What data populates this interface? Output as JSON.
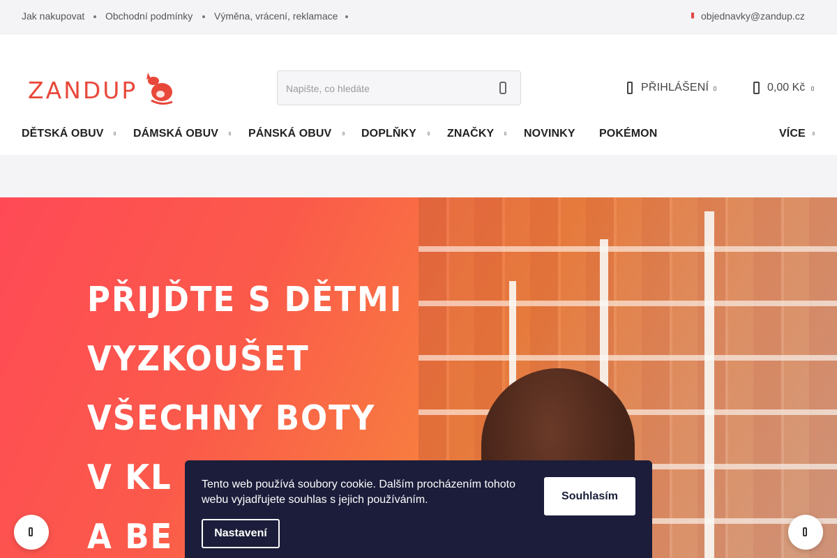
{
  "topbar": {
    "links": [
      "Jak nakupovat",
      "Obchodní podmínky",
      "Výměna, vrácení, reklamace"
    ],
    "email": "objednavky@zandup.cz"
  },
  "header": {
    "logo_text": "ZANDUP",
    "search_placeholder": "Napište, co hledáte",
    "login_label": "PŘIHLÁŠENÍ",
    "cart_total": "0,00 Kč"
  },
  "nav": {
    "items": [
      "DĚTSKÁ OBUV",
      "DÁMSKÁ OBUV",
      "PÁNSKÁ OBUV",
      "DOPLŇKY",
      "ZNAČKY",
      "NOVINKY",
      "POKÉMON"
    ],
    "more_label": "VÍCE"
  },
  "hero": {
    "lines": [
      "PŘIJĎTE S DĚTMI",
      "VYZKOUŠET",
      "VŠECHNY BOTY",
      "V KL",
      "A BE"
    ]
  },
  "cookie": {
    "text": "Tento web používá soubory cookie. Dalším procházením tohoto webu vyjadřujete souhlas s jejich používáním.",
    "agree_label": "Souhlasím",
    "settings_label": "Nastavení"
  },
  "colors": {
    "brand": "#e8483a",
    "cookie_bg": "#1b1d3a"
  }
}
